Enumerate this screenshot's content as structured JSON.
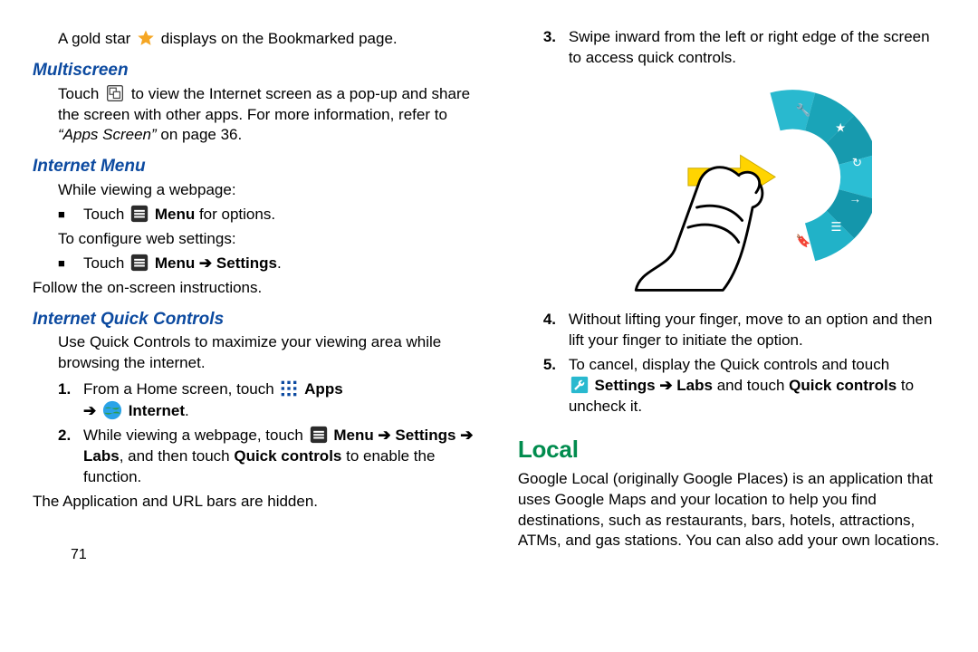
{
  "intro": {
    "pre": "A gold star ",
    "post": " displays on the Bookmarked page."
  },
  "multi": {
    "heading": "Multiscreen",
    "p1a": "Touch ",
    "p1b": " to view the Internet screen as a pop-up and share the screen with other apps. For more information, refer to ",
    "p1c": "“Apps Screen”",
    "p1d": " on page 36."
  },
  "imenu": {
    "heading": "Internet Menu",
    "p1": "While viewing a webpage:",
    "b1a": "Touch ",
    "b1b_bold": "Menu",
    "b1c": " for options.",
    "p2": "To configure web settings:",
    "b2a": "Touch ",
    "b2b_bold": "Menu ➔ Settings",
    "b2c": ".",
    "follow": "Follow the on-screen instructions."
  },
  "iqc": {
    "heading": "Internet Quick Controls",
    "p1": "Use Quick Controls to maximize your viewing area while browsing the internet.",
    "s1": {
      "num": "1.",
      "a": "From a Home screen, touch ",
      "apps": "Apps",
      "arrow": "➔ ",
      "internet": "Internet",
      "end": "."
    },
    "s2": {
      "num": "2.",
      "a": "While viewing a webpage, touch ",
      "b": "Menu ➔ Settings ➔ Labs",
      "c": ", and then touch ",
      "d": "Quick controls",
      "e": " to enable the function."
    },
    "s2_follow": "The Application and URL bars are hidden."
  },
  "right": {
    "s3": {
      "num": "3.",
      "text": "Swipe inward from the left or right edge of the screen to access quick controls."
    },
    "s4": {
      "num": "4.",
      "text": "Without lifting your finger, move to an option and then lift your finger to initiate the option."
    },
    "s5": {
      "num": "5.",
      "a": "To cancel, display the Quick controls and touch ",
      "b": "Settings ➔ Labs",
      "c": " and touch ",
      "d": "Quick controls",
      "e": " to uncheck it."
    }
  },
  "local": {
    "heading": "Local",
    "p": "Google Local (originally Google Places) is an application that uses Google Maps and your location to help you find destinations, such as restaurants, bars, hotels, attractions, ATMs, and gas stations. You can also add your own locations."
  },
  "page_no": "71"
}
